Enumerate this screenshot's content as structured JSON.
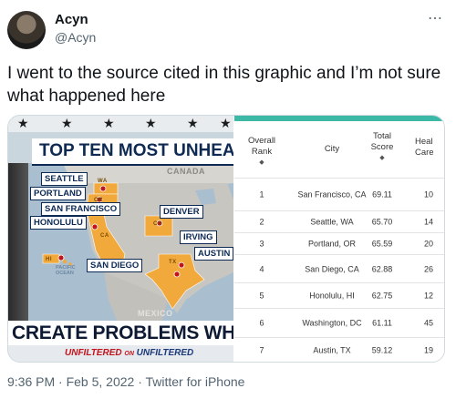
{
  "tweet": {
    "display_name": "Acyn",
    "handle": "@Acyn",
    "more_icon": "⋯",
    "text": "I went to the source cited in this graphic and I’m not sure what happened here",
    "meta": "9:36 PM · Feb 5, 2022 · Twitter for iPhone"
  },
  "graphic": {
    "headline": "TOP TEN MOST UNHEALTH",
    "map_labels": {
      "canada": "CANADA",
      "mexico": "MEXICO",
      "ocean": "PACIFIC OCEAN",
      "wa": "WA",
      "or": "OR",
      "ca": "CA",
      "co": "CO",
      "tx": "TX",
      "hi": "HI"
    },
    "cities": {
      "seattle": "SEATTLE",
      "portland": "PORTLAND",
      "san_francisco": "SAN FRANCISCO",
      "honolulu": "HONOLULU",
      "denver": "DENVER",
      "irving": "IRVING",
      "austin": "AUSTIN",
      "san_diego": "SAN DIEGO"
    },
    "chyron": "CREATE PROBLEMS WHILE PROMISING",
    "tagline_left": "UNFILTERED",
    "tagline_mid": "ON",
    "tagline_right": "UNFILTERED",
    "colors": {
      "highlight_state": "#f2a93b",
      "navy": "#0d2a55",
      "red": "#c2141b"
    }
  },
  "table": {
    "headers": {
      "rank": "Overall Rank",
      "city": "City",
      "score": "Total Score",
      "care": "Heal Care"
    },
    "sort_icon": "◆",
    "rows": [
      {
        "rank": "1",
        "city": "San Francisco, CA",
        "score": "69.11",
        "care": "10"
      },
      {
        "rank": "2",
        "city": "Seattle, WA",
        "score": "65.70",
        "care": "14"
      },
      {
        "rank": "3",
        "city": "Portland, OR",
        "score": "65.59",
        "care": "20"
      },
      {
        "rank": "4",
        "city": "San Diego, CA",
        "score": "62.88",
        "care": "26"
      },
      {
        "rank": "5",
        "city": "Honolulu, HI",
        "score": "62.75",
        "care": "12"
      },
      {
        "rank": "6",
        "city": "Washington, DC",
        "score": "61.11",
        "care": "45"
      },
      {
        "rank": "7",
        "city": "Austin, TX",
        "score": "59.12",
        "care": "19"
      }
    ],
    "accent": "#3cb8a7"
  }
}
